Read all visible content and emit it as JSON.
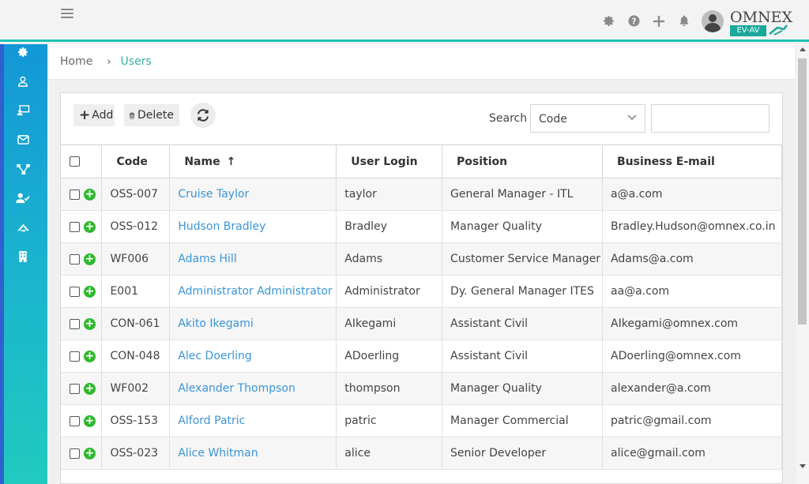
{
  "topbar": {
    "logo_text": "OMNEX",
    "logo_sub": "EV-AV",
    "icons": [
      "hamburger-icon",
      "gear-icon",
      "help-icon",
      "plus-icon",
      "bell-icon",
      "avatar"
    ]
  },
  "sidebar": {
    "items": [
      {
        "icon": "gear-icon"
      },
      {
        "icon": "user-icon"
      },
      {
        "icon": "monitor-user-icon"
      },
      {
        "icon": "mail-icon"
      },
      {
        "icon": "hierarchy-icon"
      },
      {
        "icon": "user-check-icon"
      },
      {
        "icon": "road-icon"
      },
      {
        "icon": "building-icon"
      }
    ]
  },
  "breadcrumb": {
    "home": "Home",
    "separator": "›",
    "current": "Users"
  },
  "toolbar": {
    "add_label": "Add",
    "delete_label": "Delete",
    "search_label": "Search",
    "search_field_selected": "Code",
    "search_value": ""
  },
  "table": {
    "headers": {
      "code": "Code",
      "name": "Name",
      "name_sort": "↑",
      "login": "User Login",
      "position": "Position",
      "email": "Business E-mail"
    },
    "rows": [
      {
        "code": "OSS-007",
        "name": "Cruise Taylor",
        "login": "taylor",
        "position": "General Manager - ITL",
        "email": "a@a.com"
      },
      {
        "code": "OSS-012",
        "name": "Hudson Bradley",
        "login": "Bradley",
        "position": "Manager Quality",
        "email": "Bradley.Hudson@omnex.co.in"
      },
      {
        "code": "WF006",
        "name": "Adams Hill",
        "login": "Adams",
        "position": "Customer Service Manager",
        "email": "Adams@a.com"
      },
      {
        "code": "E001",
        "name": "Administrator Administrator",
        "login": "Administrator",
        "position": "Dy. General Manager ITES",
        "email": "aa@a.com"
      },
      {
        "code": "CON-061",
        "name": "Akito Ikegami",
        "login": "AIkegami",
        "position": "Assistant Civil",
        "email": "AIkegami@omnex.com"
      },
      {
        "code": "CON-048",
        "name": "Alec Doerling",
        "login": "ADoerling",
        "position": "Assistant Civil",
        "email": "ADoerling@omnex.com"
      },
      {
        "code": "WF002",
        "name": "Alexander Thompson",
        "login": "thompson",
        "position": "Manager Quality",
        "email": "alexander@a.com"
      },
      {
        "code": "OSS-153",
        "name": "Alford Patric",
        "login": "patric",
        "position": "Manager Commercial",
        "email": "patric@gmail.com"
      },
      {
        "code": "OSS-023",
        "name": "Alice Whitman",
        "login": "alice",
        "position": "Senior Developer",
        "email": "alice@gmail.com"
      }
    ]
  },
  "colors": {
    "accent": "#1cc3b2",
    "link": "#3a95d5",
    "add_green": "#2eb82e",
    "sidebar_top": "#1397d6",
    "sidebar_bottom": "#21cabf"
  }
}
